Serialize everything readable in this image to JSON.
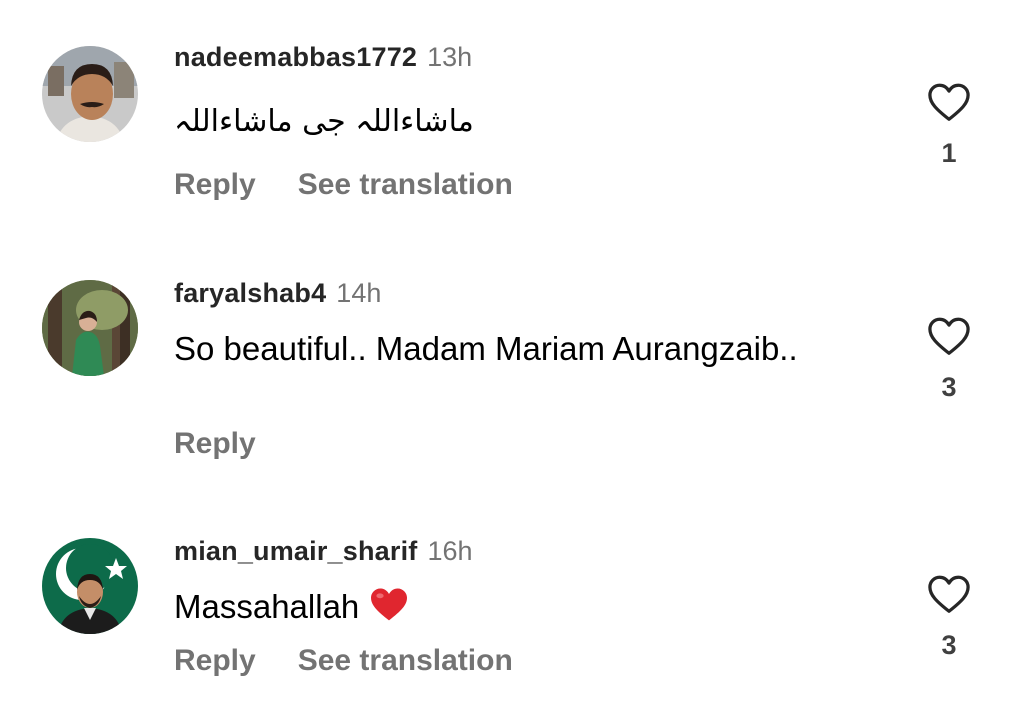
{
  "comments": [
    {
      "username": "nadeemabbas1772",
      "time": "13h",
      "text": "ماشاءاللہ جی ماشاءاللہ",
      "reply_label": "Reply",
      "translate_label": "See translation",
      "likes": "1",
      "avatar_icon": "user-avatar-photo"
    },
    {
      "username": "faryalshab4",
      "time": "14h",
      "text": "So beautiful.. Madam Mariam Aurangzaib..",
      "reply_label": "Reply",
      "likes": "3",
      "avatar_icon": "user-avatar-photo"
    },
    {
      "username": "mian_umair_sharif",
      "time": "16h",
      "text": "Massahallah",
      "text_emoji": "red-heart-emoji",
      "reply_label": "Reply",
      "translate_label": "See translation",
      "likes": "3",
      "avatar_icon": "user-avatar-photo"
    }
  ],
  "colors": {
    "username": "#262626",
    "muted": "#737373",
    "heart_emoji": "#e0262f",
    "avatar3_bg": "#0d6b4a"
  }
}
